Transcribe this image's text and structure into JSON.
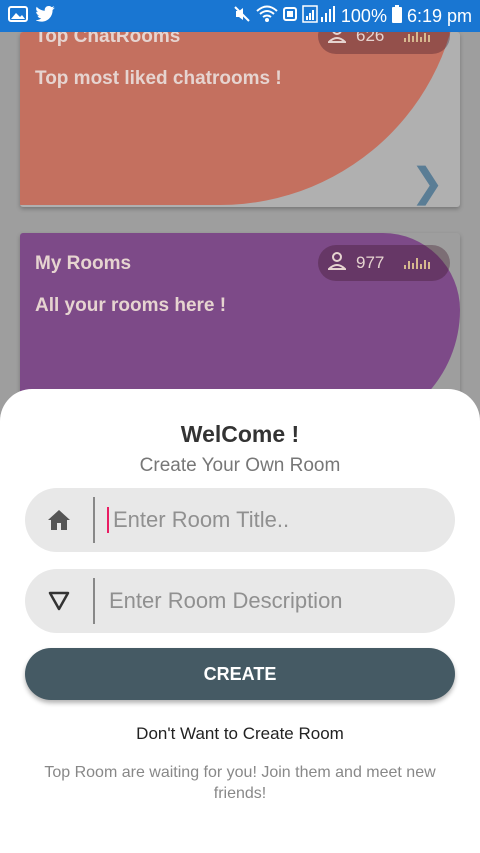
{
  "status_bar": {
    "battery_percent": "100%",
    "time": "6:19 pm",
    "left_icons": [
      "gallery-icon",
      "twitter-icon"
    ],
    "right_icons": [
      "mute-icon",
      "wifi-icon",
      "signal-icon",
      "battery-icon"
    ]
  },
  "cards": [
    {
      "title": "Top ChatRooms",
      "subtitle": "Top most liked chatrooms !",
      "count": "626",
      "color": "#c4705f"
    },
    {
      "title": "My Rooms",
      "subtitle": "All your rooms here !",
      "count": "977",
      "color": "#7d4a88"
    }
  ],
  "sheet": {
    "title": "WelCome !",
    "subtitle": "Create Your Own Room",
    "title_field": {
      "placeholder": "Enter Room Title..",
      "icon": "home-icon"
    },
    "description_field": {
      "placeholder": "Enter Room Description",
      "icon": "triangle-down-icon"
    },
    "create_button": "CREATE",
    "skip_link": "Don't Want to Create Room",
    "info_text": "Top Room are waiting for you! Join them and meet new friends!"
  },
  "colors": {
    "status_bar": "#1976d2",
    "button": "#455a64",
    "accent_caret": "#e91e63"
  }
}
